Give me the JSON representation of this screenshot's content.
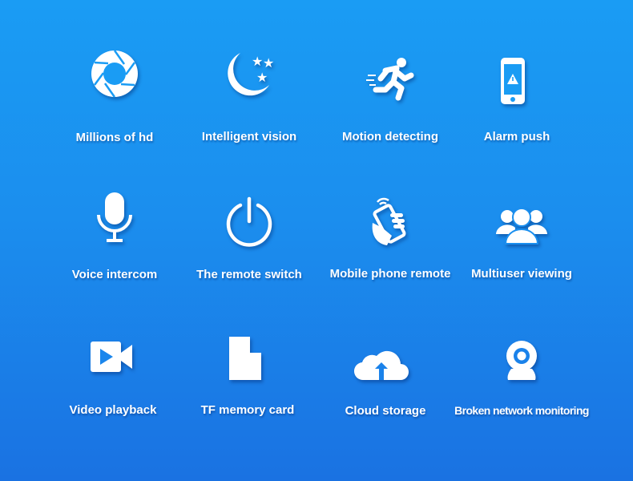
{
  "background": {
    "top": "#1a9cf4",
    "bottom": "#1a72e2"
  },
  "features": [
    {
      "label": "Millions of hd",
      "icon": "camera-aperture-icon"
    },
    {
      "label": "Intelligent vision",
      "icon": "moon-stars-icon"
    },
    {
      "label": "Motion detecting",
      "icon": "running-person-icon"
    },
    {
      "label": "Alarm push",
      "icon": "phone-alert-icon"
    },
    {
      "label": "Voice intercom",
      "icon": "microphone-icon"
    },
    {
      "label": "The remote switch",
      "icon": "power-icon"
    },
    {
      "label": "Mobile phone remote",
      "icon": "hand-phone-wifi-icon"
    },
    {
      "label": "Multiuser viewing",
      "icon": "users-group-icon"
    },
    {
      "label": "Video playback",
      "icon": "video-camera-icon"
    },
    {
      "label": "TF memory card",
      "icon": "sd-card-icon"
    },
    {
      "label": "Cloud storage",
      "icon": "cloud-upload-icon"
    },
    {
      "label": "Broken network monitoring",
      "icon": "webcam-icon"
    }
  ]
}
